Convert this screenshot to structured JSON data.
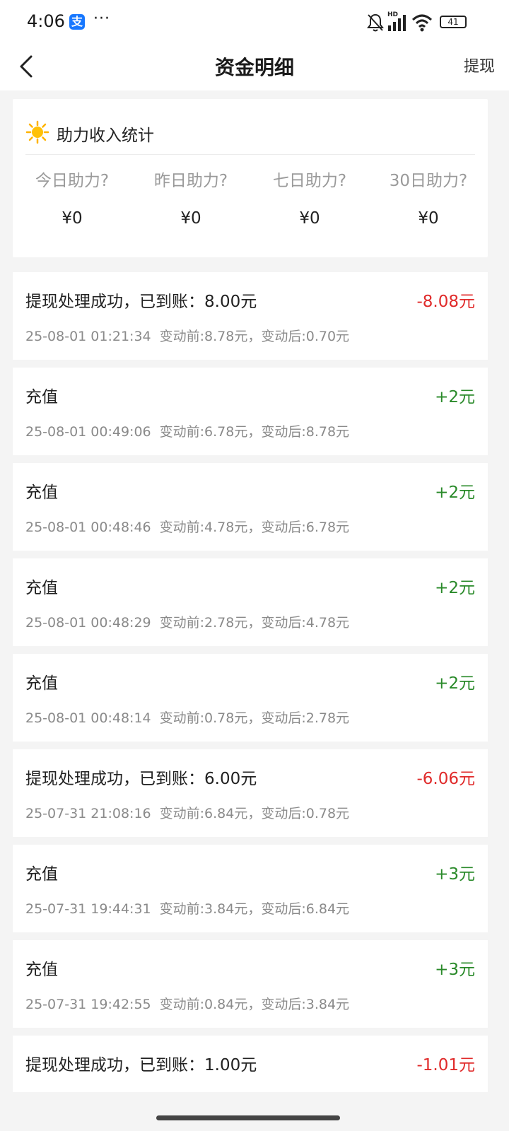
{
  "status_bar": {
    "time": "4:06",
    "alipay_glyph": "支",
    "more": "···",
    "hd_label": "HD",
    "battery": "41",
    "icons": [
      "alipay-icon",
      "mute-bell-icon",
      "signal-icon",
      "wifi-icon",
      "battery-icon"
    ]
  },
  "nav": {
    "title": "资金明细",
    "action": "提现",
    "back_icon": "chevron-left-icon"
  },
  "stats": {
    "title": "助力收入统计",
    "icon": "sun-icon",
    "items": [
      {
        "label": "今日助力?",
        "value": "¥0"
      },
      {
        "label": "昨日助力?",
        "value": "¥0"
      },
      {
        "label": "七日助力?",
        "value": "¥0"
      },
      {
        "label": "30日助力?",
        "value": "¥0"
      }
    ]
  },
  "records": [
    {
      "title": "提现处理成功，已到账：8.00元",
      "amount": "-8.08元",
      "type": "neg",
      "time": "25-08-01 01:21:34",
      "change": "变动前:8.78元，变动后:0.70元"
    },
    {
      "title": "充值",
      "amount": "+2元",
      "type": "pos",
      "time": "25-08-01 00:49:06",
      "change": "变动前:6.78元，变动后:8.78元"
    },
    {
      "title": "充值",
      "amount": "+2元",
      "type": "pos",
      "time": "25-08-01 00:48:46",
      "change": "变动前:4.78元，变动后:6.78元"
    },
    {
      "title": "充值",
      "amount": "+2元",
      "type": "pos",
      "time": "25-08-01 00:48:29",
      "change": "变动前:2.78元，变动后:4.78元"
    },
    {
      "title": "充值",
      "amount": "+2元",
      "type": "pos",
      "time": "25-08-01 00:48:14",
      "change": "变动前:0.78元，变动后:2.78元"
    },
    {
      "title": "提现处理成功，已到账：6.00元",
      "amount": "-6.06元",
      "type": "neg",
      "time": "25-07-31 21:08:16",
      "change": "变动前:6.84元，变动后:0.78元"
    },
    {
      "title": "充值",
      "amount": "+3元",
      "type": "pos",
      "time": "25-07-31 19:44:31",
      "change": "变动前:3.84元，变动后:6.84元"
    },
    {
      "title": "充值",
      "amount": "+3元",
      "type": "pos",
      "time": "25-07-31 19:42:55",
      "change": "变动前:0.84元，变动后:3.84元"
    },
    {
      "title": "提现处理成功，已到账：1.00元",
      "amount": "-1.01元",
      "type": "neg",
      "time": "",
      "change": ""
    }
  ],
  "colors": {
    "negative": "#e02b2b",
    "positive": "#2a8a2a",
    "background": "#f4f4f4",
    "alipay_blue": "#1677ff"
  }
}
